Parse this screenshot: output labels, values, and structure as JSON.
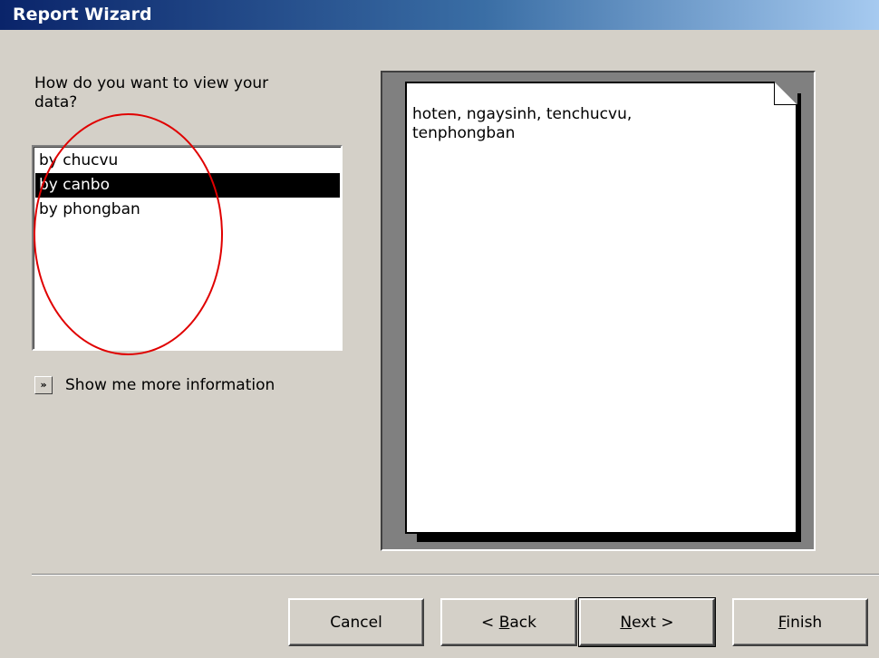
{
  "window": {
    "title": "Report Wizard"
  },
  "prompt": "How do you want to view your\ndata?",
  "view_list": {
    "items": [
      {
        "label": "by chucvu",
        "selected": false
      },
      {
        "label": "by canbo",
        "selected": true
      },
      {
        "label": "by phongban",
        "selected": false
      }
    ]
  },
  "more_info": {
    "label": "Show me more information",
    "icon": "double-chevron-right-icon"
  },
  "preview": {
    "line1": "hoten, ngaysinh, tenchucvu,",
    "line2": "tenphongban"
  },
  "buttons": {
    "cancel": "Cancel",
    "back_prefix": "< ",
    "back_mnemonic": "B",
    "back_rest": "ack",
    "next_mnemonic": "N",
    "next_rest": "ext >",
    "finish_mnemonic": "F",
    "finish_rest": "inish"
  },
  "colors": {
    "annotation": "#e00000",
    "selection": "#000000",
    "titlebar_start": "#0a246a"
  }
}
